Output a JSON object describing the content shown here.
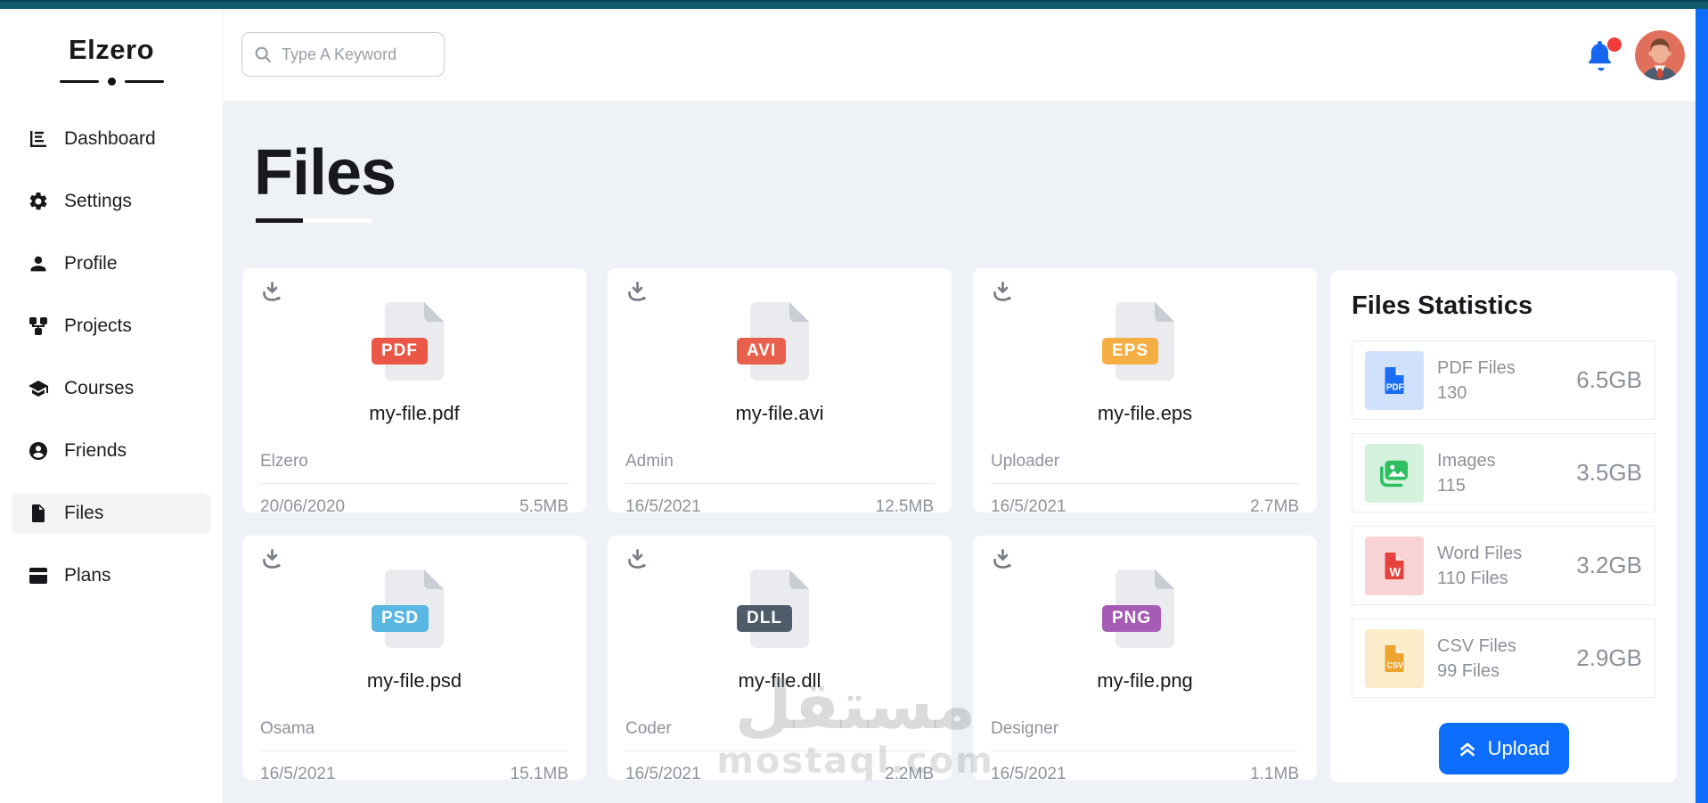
{
  "brand": {
    "name": "Elzero"
  },
  "topbar": {
    "search_placeholder": "Type A Keyword"
  },
  "sidebar": {
    "items": [
      {
        "label": "Dashboard",
        "active": false
      },
      {
        "label": "Settings",
        "active": false
      },
      {
        "label": "Profile",
        "active": false
      },
      {
        "label": "Projects",
        "active": false
      },
      {
        "label": "Courses",
        "active": false
      },
      {
        "label": "Friends",
        "active": false
      },
      {
        "label": "Files",
        "active": true
      },
      {
        "label": "Plans",
        "active": false
      }
    ]
  },
  "page": {
    "title": "Files"
  },
  "files": [
    {
      "name": "my-file.pdf",
      "type": "PDF",
      "badge_color": "#ea5747",
      "uploader": "Elzero",
      "date": "20/06/2020",
      "size": "5.5MB"
    },
    {
      "name": "my-file.avi",
      "type": "AVI",
      "badge_color": "#e8604c",
      "uploader": "Admin",
      "date": "16/5/2021",
      "size": "12.5MB"
    },
    {
      "name": "my-file.eps",
      "type": "EPS",
      "badge_color": "#f5ae44",
      "uploader": "Uploader",
      "date": "16/5/2021",
      "size": "2.7MB"
    },
    {
      "name": "my-file.psd",
      "type": "PSD",
      "badge_color": "#58b7e1",
      "uploader": "Osama",
      "date": "16/5/2021",
      "size": "15.1MB"
    },
    {
      "name": "my-file.dll",
      "type": "DLL",
      "badge_color": "#4e5b69",
      "uploader": "Coder",
      "date": "16/5/2021",
      "size": "2.2MB"
    },
    {
      "name": "my-file.png",
      "type": "PNG",
      "badge_color": "#a55cb4",
      "uploader": "Designer",
      "date": "16/5/2021",
      "size": "1.1MB"
    }
  ],
  "statistics": {
    "title": "Files Statistics",
    "rows": [
      {
        "label": "PDF Files",
        "count": "130",
        "value": "6.5GB",
        "icon": "pdf-file-icon",
        "bg": "#cfe1fc",
        "fg": "#1b6ef3"
      },
      {
        "label": "Images",
        "count": "115",
        "value": "3.5GB",
        "icon": "image-icon",
        "bg": "#d4f2de",
        "fg": "#2fbe61"
      },
      {
        "label": "Word Files",
        "count": "110 Files",
        "value": "3.2GB",
        "icon": "word-file-icon",
        "bg": "#f9d2d6",
        "fg": "#e6413c"
      },
      {
        "label": "CSV Files",
        "count": "99 Files",
        "value": "2.9GB",
        "icon": "csv-file-icon",
        "bg": "#fcecca",
        "fg": "#eda52f"
      }
    ],
    "upload_label": "Upload"
  },
  "watermark": {
    "arabic": "مستقل",
    "latin": "mostaql.com"
  },
  "colors": {
    "topbar_teal": "#0e5c6d",
    "scrollbar_blue": "#0d6efd",
    "upload_blue": "#0d6efd",
    "bell_blue": "#1766f0",
    "notification_red": "#f13b3b",
    "main_background": "#eef1f5"
  }
}
